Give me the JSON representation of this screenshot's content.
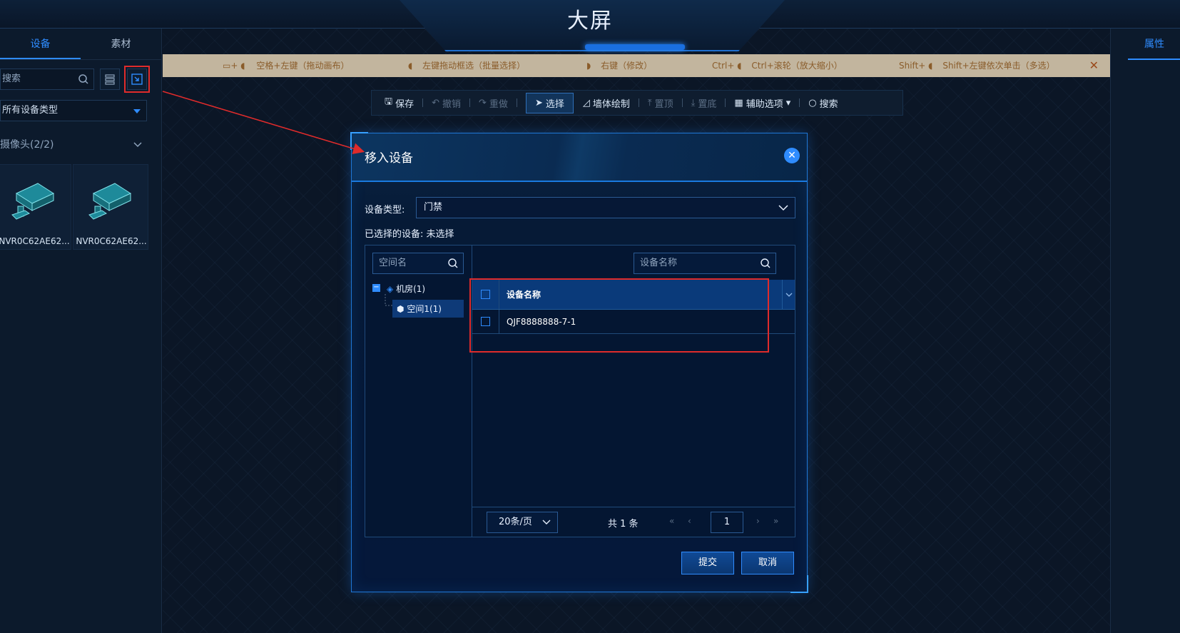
{
  "header": {
    "title": "大屏"
  },
  "left_panel": {
    "tabs": [
      "设备",
      "素材"
    ],
    "search_placeholder": "搜索",
    "type_select": "所有设备类型",
    "group_title": "摄像头(2/2)",
    "devices": [
      {
        "name": "NVR0C62AE62..."
      },
      {
        "name": "NVR0C62AE62..."
      }
    ]
  },
  "right_panel": {
    "tab": "属性"
  },
  "hint_bar": {
    "hints": [
      {
        "keys": "▭+",
        "text": "空格+左键（拖动画布）"
      },
      {
        "keys": "",
        "text": "左键拖动框选（批量选择）"
      },
      {
        "keys": "",
        "text": "右键（修改）"
      },
      {
        "keys": "Ctrl+",
        "text": "Ctrl+滚轮（放大缩小）"
      },
      {
        "keys": "Shift+",
        "text": "Shift+左键依次单击（多选）"
      }
    ],
    "close": "✕"
  },
  "toolbar": {
    "items": [
      {
        "label": "保存",
        "icon": "save-icon"
      },
      {
        "label": "撤销",
        "icon": "undo-icon"
      },
      {
        "label": "重做",
        "icon": "redo-icon"
      },
      {
        "label": "选择",
        "icon": "cursor-icon"
      },
      {
        "label": "墙体绘制",
        "icon": "draw-icon"
      },
      {
        "label": "置顶",
        "icon": "to-top-icon"
      },
      {
        "label": "置底",
        "icon": "to-bottom-icon"
      },
      {
        "label": "辅助选项",
        "icon": "table-icon"
      },
      {
        "label": "搜索",
        "icon": "search-icon"
      }
    ]
  },
  "modal": {
    "title": "移入设备",
    "close": "✕",
    "type_label": "设备类型:",
    "type_value": "门禁",
    "selected_label": "已选择的设备:",
    "selected_value": "未选择",
    "space_search_placeholder": "空间名",
    "device_search_placeholder": "设备名称",
    "tree": {
      "root": "机房(1)",
      "child": "空间1(1)"
    },
    "table": {
      "header": "设备名称",
      "rows": [
        {
          "name": "QJF8888888-7-1"
        }
      ]
    },
    "pager": {
      "page_size": "20条/页",
      "total": "共 1 条",
      "current_page": "1"
    },
    "submit": "提交",
    "cancel": "取消"
  },
  "colors": {
    "accent": "#2f8cff",
    "highlight": "#e02b2b",
    "hint_bg": "#c2b59e"
  }
}
